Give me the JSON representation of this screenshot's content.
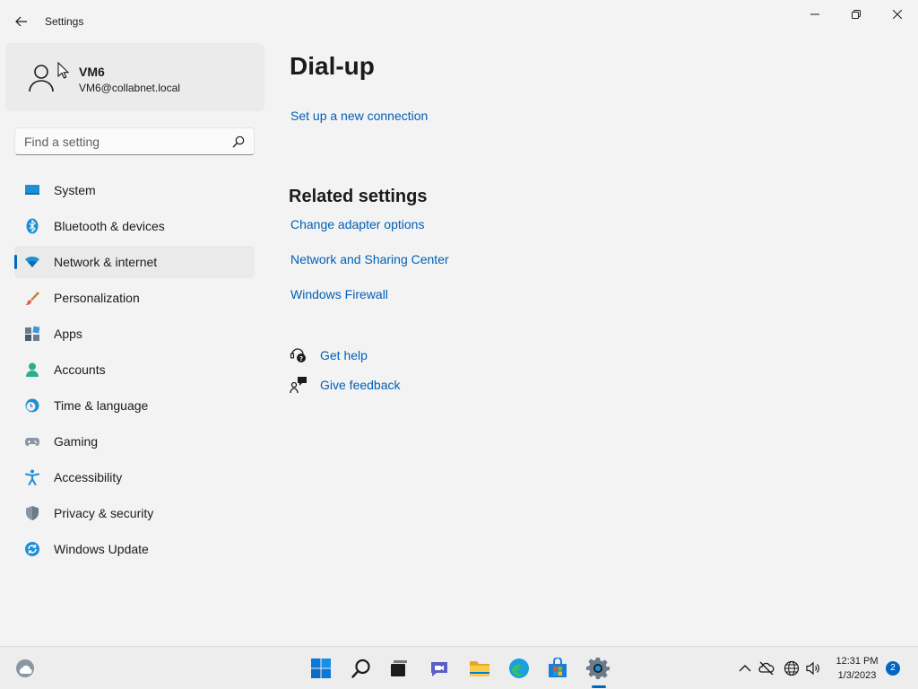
{
  "window": {
    "title": "Settings"
  },
  "user": {
    "name": "VM6",
    "email": "VM6@collabnet.local"
  },
  "search": {
    "placeholder": "Find a setting"
  },
  "sidebar": {
    "items": [
      {
        "label": "System",
        "icon": "system-icon",
        "selected": false
      },
      {
        "label": "Bluetooth & devices",
        "icon": "bluetooth-icon",
        "selected": false
      },
      {
        "label": "Network & internet",
        "icon": "wifi-icon",
        "selected": true
      },
      {
        "label": "Personalization",
        "icon": "brush-icon",
        "selected": false
      },
      {
        "label": "Apps",
        "icon": "apps-icon",
        "selected": false
      },
      {
        "label": "Accounts",
        "icon": "accounts-icon",
        "selected": false
      },
      {
        "label": "Time & language",
        "icon": "clock-globe-icon",
        "selected": false
      },
      {
        "label": "Gaming",
        "icon": "gamepad-icon",
        "selected": false
      },
      {
        "label": "Accessibility",
        "icon": "accessibility-icon",
        "selected": false
      },
      {
        "label": "Privacy & security",
        "icon": "shield-icon",
        "selected": false
      },
      {
        "label": "Windows Update",
        "icon": "update-icon",
        "selected": false
      }
    ]
  },
  "main": {
    "title": "Dial-up",
    "setup_link": "Set up a new connection",
    "related_title": "Related settings",
    "related_links": [
      "Change adapter options",
      "Network and Sharing Center",
      "Windows Firewall"
    ],
    "help": {
      "get_help": "Get help",
      "give_feedback": "Give feedback"
    }
  },
  "taskbar": {
    "time": "12:31 PM",
    "date": "1/3/2023",
    "notification_count": "2"
  },
  "colors": {
    "accent": "#0067c0",
    "link": "#005fb8",
    "background": "#f3f3f3"
  }
}
